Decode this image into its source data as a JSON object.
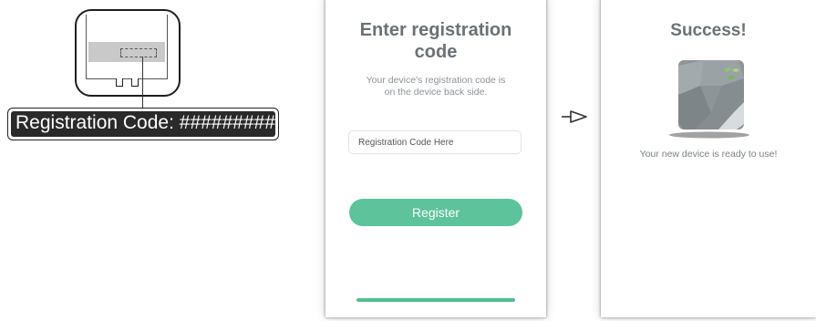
{
  "device_illustration": {
    "code_banner_text": "Registration Code: ##########"
  },
  "screen_register": {
    "title": "Enter registration code",
    "subtitle": "Your device's registration code is on the device back side.",
    "input": {
      "placeholder": "Registration Code Here",
      "value": ""
    },
    "button_label": "Register",
    "progress_fraction": 1.0
  },
  "screen_success": {
    "title": "Success!",
    "message": "Your new device is ready to use!"
  },
  "icons": [
    "arrow-right-icon",
    "device-icon",
    "leaf-icon"
  ],
  "colors": {
    "accent_green": "#5cc39a",
    "title_gray": "#6a7277",
    "device_gray": "#8d9599"
  }
}
